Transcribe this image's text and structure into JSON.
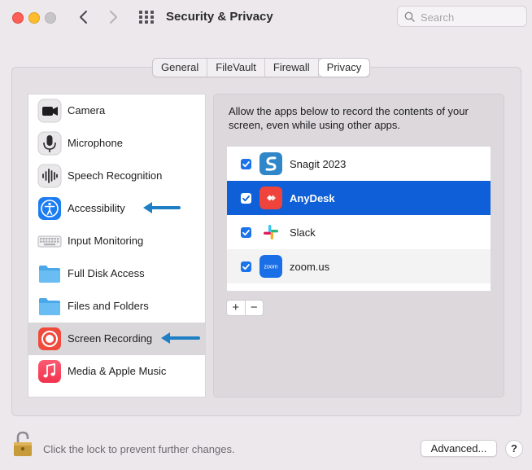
{
  "window": {
    "title": "Security & Privacy"
  },
  "search": {
    "placeholder": "Search"
  },
  "tabs": [
    {
      "label": "General"
    },
    {
      "label": "FileVault"
    },
    {
      "label": "Firewall"
    },
    {
      "label": "Privacy",
      "active": true
    }
  ],
  "sidebar": {
    "items": [
      {
        "label": "Camera",
        "icon": "camera-icon"
      },
      {
        "label": "Microphone",
        "icon": "microphone-icon"
      },
      {
        "label": "Speech Recognition",
        "icon": "speech-recognition-icon"
      },
      {
        "label": "Accessibility",
        "icon": "accessibility-icon"
      },
      {
        "label": "Input Monitoring",
        "icon": "keyboard-icon"
      },
      {
        "label": "Full Disk Access",
        "icon": "folder-icon"
      },
      {
        "label": "Files and Folders",
        "icon": "folder-icon"
      },
      {
        "label": "Screen Recording",
        "icon": "screen-recording-icon",
        "selected": true
      },
      {
        "label": "Media & Apple Music",
        "icon": "music-icon"
      }
    ]
  },
  "main": {
    "description": "Allow the apps below to record the contents of your screen, even while using other apps.",
    "apps": [
      {
        "name": "Snagit 2023",
        "checked": true,
        "icon": "snagit-icon"
      },
      {
        "name": "AnyDesk",
        "checked": true,
        "selected": true,
        "icon": "anydesk-icon"
      },
      {
        "name": "Slack",
        "checked": true,
        "icon": "slack-icon"
      },
      {
        "name": "zoom.us",
        "checked": true,
        "icon": "zoom-icon",
        "icon_text": "zoom"
      }
    ],
    "add_label": "+",
    "remove_label": "−"
  },
  "footer": {
    "lock_text": "Click the lock to prevent further changes.",
    "advanced_label": "Advanced...",
    "help_label": "?"
  },
  "colors": {
    "selection_blue": "#0e5fd8",
    "annotation_arrow": "#1f7fc4"
  }
}
